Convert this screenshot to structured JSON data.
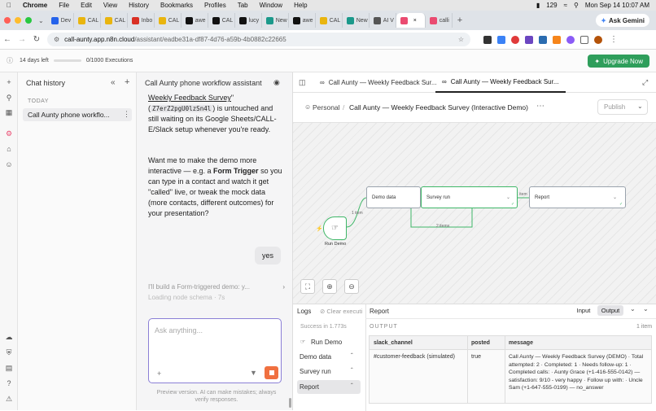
{
  "menubar": {
    "app": "Chrome",
    "items": [
      "File",
      "Edit",
      "View",
      "History",
      "Bookmarks",
      "Profiles",
      "Tab",
      "Window",
      "Help"
    ],
    "battery": "129",
    "clock": "Mon Sep 14  10:07 AM"
  },
  "tabs": [
    {
      "label": "Dev",
      "color": "#2563eb"
    },
    {
      "label": "CAL",
      "color": "#e9b50f"
    },
    {
      "label": "CAL",
      "color": "#e9b50f"
    },
    {
      "label": "Inbo",
      "color": "#d93025"
    },
    {
      "label": "CAL",
      "color": "#e9b50f"
    },
    {
      "label": "awe",
      "color": "#111111"
    },
    {
      "label": "CAL",
      "color": "#111111"
    },
    {
      "label": "lucy",
      "color": "#111111"
    },
    {
      "label": "New",
      "color": "#1b998b"
    },
    {
      "label": "awe",
      "color": "#111111"
    },
    {
      "label": "CAL",
      "color": "#e9b50f"
    },
    {
      "label": "New",
      "color": "#1b998b"
    },
    {
      "label": "AI V",
      "color": "#555555"
    },
    {
      "label": "",
      "color": "#ea4b71"
    },
    {
      "label": "calli",
      "color": "#ea4b71"
    }
  ],
  "ask_gemini": "Ask Gemini",
  "url": {
    "host": "call-aunty.app.n8n.cloud",
    "path": "/assistant/eadbe31a-df87-4d76-a59b-4b0882c22665"
  },
  "trial": {
    "days": "14 days left",
    "executions": "0/1000 Executions",
    "upgrade": "Upgrade Now"
  },
  "history": {
    "title": "Chat history",
    "today": "TODAY",
    "item": "Call Aunty phone workflo..."
  },
  "assistant": {
    "title": "Call Aunty phone workflow assistant",
    "msg1_a": "Weekly Feedback Survey",
    "msg1_b": "\" (",
    "msg1_code": "Z7erZ2pgU0lzSn4l",
    "msg1_c": ") is untouched and still waiting on its Google Sheets/CALL-E/Slack setup whenever you're ready.",
    "msg2_a": "Want me to make the demo more interactive — e.g. a ",
    "msg2_b": "Form Trigger",
    "msg2_c": " so you can type in a contact and watch it get \"called\" live, or tweak the mock data (more contacts, different outcomes) for your presentation?",
    "user_reply": "yes",
    "thinking": "I'll build a Form-triggered demo: y...",
    "loading": "Loading node schema · 7s",
    "input_placeholder": "Ask anything...",
    "disclaimer": "Preview version. AI can make mistakes; always verify responses."
  },
  "workflow": {
    "tab1": "Call Aunty — Weekly Feedback Sur...",
    "tab2": "Call Aunty — Weekly Feedback Sur...",
    "breadcrumb_owner": "Personal",
    "breadcrumb_title": "Call Aunty — Weekly Feedback Survey (Interactive Demo)",
    "publish": "Publish",
    "nodes": {
      "trigger": "Run Demo",
      "demo": "Demo data",
      "survey": "Survey run",
      "report": "Report"
    },
    "edge_labels": {
      "e1": "1 item",
      "e2": "2 items",
      "e3": "1 item"
    },
    "loop_label": "2 items"
  },
  "logs": {
    "title": "Logs",
    "clear": "Clear executi",
    "success": "Success in 1.773s",
    "steps": [
      "Run Demo",
      "Demo data",
      "Survey run",
      "Report"
    ],
    "report_title": "Report",
    "input_tab": "Input",
    "output_tab": "Output",
    "output_label": "OUTPUT",
    "items": "1 item",
    "columns": [
      "slack_channel",
      "posted",
      "message"
    ],
    "row": {
      "slack_channel": "#customer-feedback (simulated)",
      "posted": "true",
      "message": "Call Aunty — Weekly Feedback Survey (DEMO) · Total attempted: 2 · Completed: 1 · Needs follow-up: 1 · Completed calls: · Aunty Grace (+1-416-555-0142) — satisfaction: 9/10 - very happy · Follow up with: · Uncle Sam (+1-647-555-0199) — no_answer"
    }
  }
}
